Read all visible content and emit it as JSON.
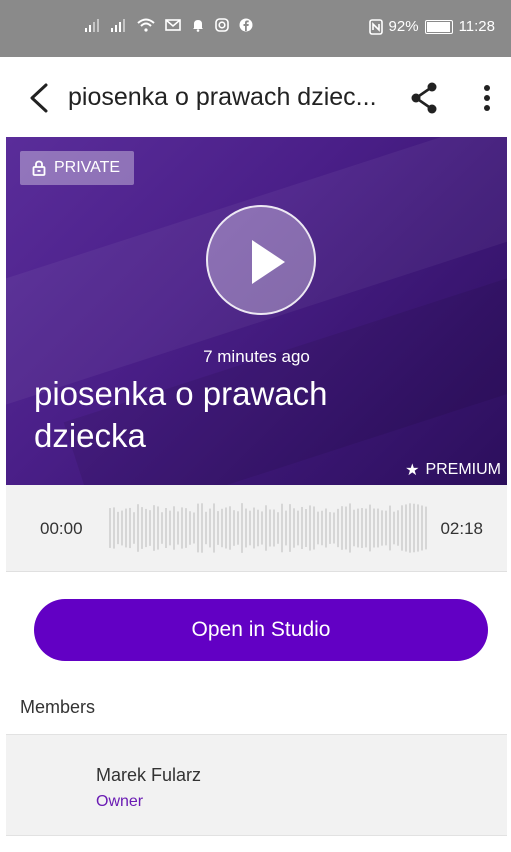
{
  "status_bar": {
    "time": "11:28",
    "battery_percent": "92%",
    "battery_level": 0.92,
    "icons": [
      "signal-icon",
      "signal-icon",
      "wifi-icon",
      "mail-icon",
      "notification-bell-icon",
      "instagram-icon",
      "facebook-icon",
      "nfc-icon",
      "battery-icon"
    ]
  },
  "app_bar": {
    "title": "piosenka o prawach dziec...",
    "icons": [
      "back-icon",
      "share-icon",
      "more-vert-icon"
    ]
  },
  "hero": {
    "private_label": "PRIVATE",
    "time_ago": "7 minutes ago",
    "song_title": "piosenka o prawach dziecka",
    "premium_label": "PREMIUM",
    "colors": {
      "gradient_start": "#5a2d9a",
      "gradient_end": "#2c0f5c"
    }
  },
  "player": {
    "current_time": "00:00",
    "total_time": "02:18"
  },
  "open_in_studio_label": "Open in Studio",
  "members": {
    "heading": "Members",
    "items": [
      {
        "name": "Marek Fularz",
        "role": "Owner"
      }
    ]
  },
  "colors": {
    "accent": "#6200c4",
    "role_text": "#6a1bb3"
  }
}
